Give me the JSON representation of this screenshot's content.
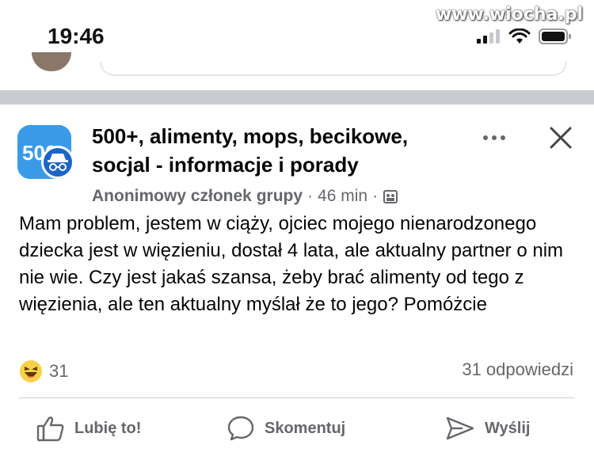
{
  "status_bar": {
    "time": "19:46",
    "watermark": "www.wiocha.pl"
  },
  "post": {
    "group_name": "500+, alimenty, mops, becikowe, socjal - informacje i porady",
    "author": "Anonimowy członek grupy",
    "time_ago": "46 min",
    "separator": "·",
    "body": "Mam problem, jestem w ciąży, ojciec mojego nienarodzonego dziecka jest w więzieniu, dostał 4 lata, ale aktualny partner o nim nie wie. Czy jest jakaś szansa, żeby brać alimenty od tego z więzienia, ale ten aktualny myślał że to jego? Pomóżcie",
    "reaction_count": "31",
    "comments_label": "31 odpowiedzi",
    "group_avatar_text": "500"
  },
  "actions": {
    "like": "Lubię to!",
    "comment": "Skomentuj",
    "share": "Wyślij"
  },
  "colors": {
    "accent": "#1877f2",
    "secondary_text": "#65676b",
    "divider": "#c9ccd1",
    "avatar_blue": "#3a9ae8"
  },
  "icons": [
    "signal-icon",
    "wifi-icon",
    "battery-icon",
    "more-icon",
    "close-icon",
    "group-privacy-icon",
    "haha-reaction-icon",
    "like-icon",
    "comment-icon",
    "share-icon"
  ]
}
